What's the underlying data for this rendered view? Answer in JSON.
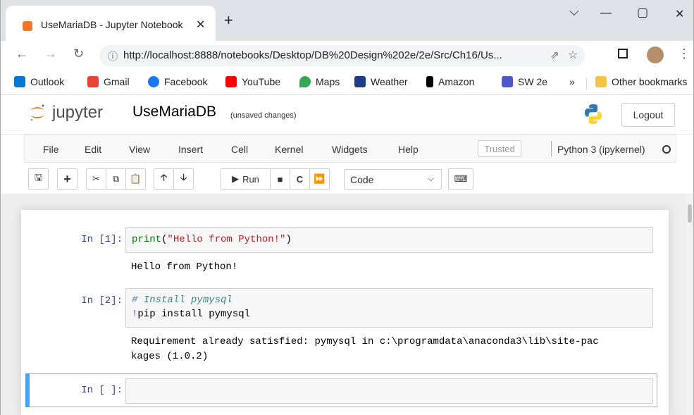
{
  "browser": {
    "tab_title": "UseMariaDB - Jupyter Notebook",
    "tab_close": "✕",
    "new_tab": "+",
    "window_controls": {
      "minimize_icon": "chevron-down-icon",
      "min": "—",
      "max": "▢",
      "close": "✕",
      "dropdown": "⌵"
    },
    "url": "http://localhost:8888/notebooks/Desktop/DB%20Design%202e/2e/Src/Ch16/Us...",
    "info_icon": "ⓘ",
    "bookmarks": [
      {
        "label": "Outlook",
        "color": "#0078d4"
      },
      {
        "label": "Gmail",
        "color": "#ea4335"
      },
      {
        "label": "Facebook",
        "color": "#1877f2"
      },
      {
        "label": "YouTube",
        "color": "#ff0000"
      },
      {
        "label": "Maps",
        "color": "#34a853"
      },
      {
        "label": "Weather",
        "color": "#1f3c88"
      },
      {
        "label": "Amazon",
        "color": "#000000"
      },
      {
        "label": "SW 2e",
        "color": "#5059c9"
      }
    ],
    "bookmarks_more": "»",
    "other_bookmarks": "Other bookmarks"
  },
  "jupyter": {
    "logo_text": "jupyter",
    "notebook_name": "UseMariaDB",
    "save_status": "(unsaved changes)",
    "logout_label": "Logout",
    "menu": [
      "File",
      "Edit",
      "View",
      "Insert",
      "Cell",
      "Kernel",
      "Widgets",
      "Help"
    ],
    "trusted_label": "Trusted",
    "kernel_name": "Python 3 (ipykernel)",
    "toolbar": {
      "run_label": "Run",
      "cell_type": "Code"
    }
  },
  "cells": [
    {
      "prompt": "In [1]:",
      "code_lines": [
        "print(\"Hello from Python!\")"
      ],
      "output": "Hello from Python!"
    },
    {
      "prompt": "In [2]:",
      "code_lines": [
        "# Install pymysql",
        "!pip install pymysql"
      ],
      "output": "Requirement already satisfied: pymysql in c:\\programdata\\anaconda3\\lib\\site-pac\nkages (1.0.2)"
    },
    {
      "prompt": "In [ ]:",
      "code_lines": [
        ""
      ],
      "output": ""
    }
  ],
  "colors": {
    "prompt": "#303f9f",
    "string": "#ba2121",
    "builtin": "#008000",
    "comment": "#408080",
    "selected_bar": "#42a5f5",
    "jupyter_orange": "#f37726"
  }
}
